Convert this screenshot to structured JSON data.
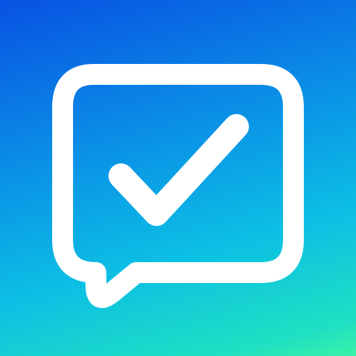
{
  "app_icon": {
    "icon": "chat-bubble-checkmark-icon",
    "colors": {
      "gradient_top": "#0852e2",
      "gradient_mid": "#0cc0e4",
      "gradient_bottom": "#38f2a8",
      "glyph": "#ffffff"
    }
  }
}
